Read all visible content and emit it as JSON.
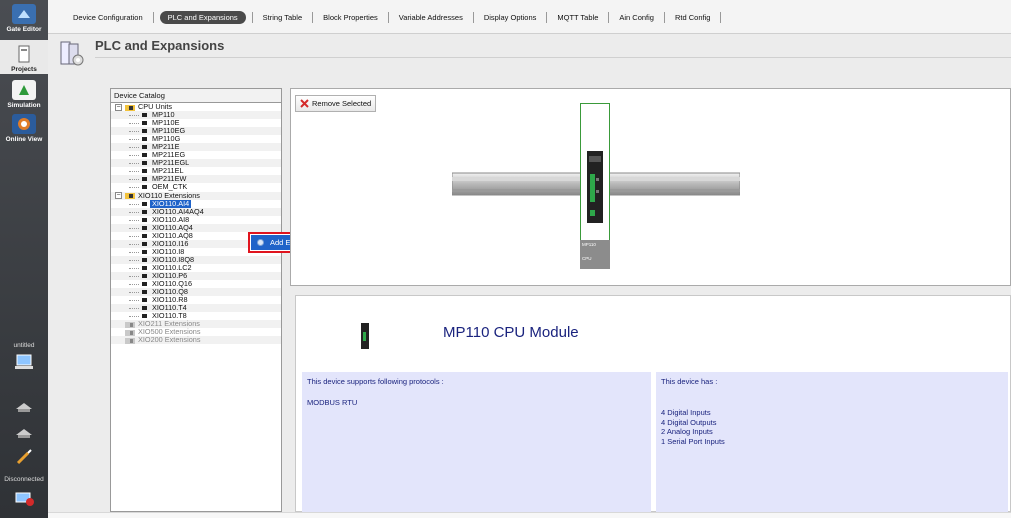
{
  "rail": {
    "gate_editor": "Gate Editor",
    "projects": "Projects",
    "simulation": "Simulation",
    "online_view": "Online View",
    "project_name": "untitled",
    "connection_status": "Disconnected"
  },
  "tabs": [
    "Device Configuration",
    "PLC and Expansions",
    "String Table",
    "Block Properties",
    "Variable Addresses",
    "Display Options",
    "MQTT Table",
    "Ain Config",
    "Rtd Config"
  ],
  "active_tab": "PLC and Expansions",
  "page": {
    "title": "PLC and Expansions"
  },
  "catalog": {
    "header": "Device Catalog",
    "cpu_group": "CPU Units",
    "cpu_units": [
      "MP110",
      "MP110E",
      "MP110EG",
      "MP110G",
      "MP211E",
      "MP211EG",
      "MP211EGL",
      "MP211EL",
      "MP211EW",
      "OEM_CTK"
    ],
    "xio110_group": "XIO110 Extensions",
    "xio110_items": [
      "XIO110.AI4",
      "XIO110.AI4AQ4",
      "XIO110.AI8",
      "XIO110.AQ4",
      "XIO110.AQ8",
      "XIO110.I16",
      "XIO110.I8",
      "XIO110.I8Q8",
      "XIO110.LC2",
      "XIO110.P6",
      "XIO110.Q16",
      "XIO110.Q8",
      "XIO110.R8",
      "XIO110.T4",
      "XIO110.T8"
    ],
    "selected_item": "XIO110.AI4",
    "disabled_groups": [
      "XIO211 Extensions",
      "XIO500 Extensions",
      "XIO200 Extensions"
    ]
  },
  "context_menu": {
    "add_extension": "Add Extension Module"
  },
  "rack": {
    "remove_button": "Remove Selected",
    "module_name": "MP110",
    "module_type": "CPU"
  },
  "info": {
    "title": "MP110 CPU Module",
    "protocols_label": "This device supports following protocols :",
    "protocols": [
      "MODBUS RTU"
    ],
    "has_label": "This device has :",
    "features": [
      "4 Digital Inputs",
      "4 Digital Outputs",
      "2 Analog Inputs",
      "1 Serial Port Inputs"
    ]
  },
  "colors": {
    "selection": "#1f63c9",
    "highlight_border": "#e0141e",
    "info_text": "#1a237e",
    "info_bg": "#e3e5fb",
    "module_border": "#3a9a3a"
  }
}
